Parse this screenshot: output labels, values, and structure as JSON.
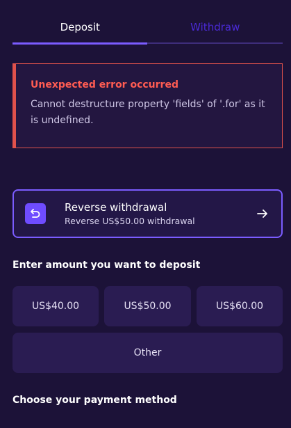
{
  "tabs": {
    "deposit": "Deposit",
    "withdraw": "Withdraw"
  },
  "error": {
    "title": "Unexpected error occurred",
    "message": "Cannot destructure property 'fields' of '.for' as it is undefined."
  },
  "reverse_withdrawal": {
    "title": "Reverse withdrawal",
    "subtitle": "Reverse US$50.00 withdrawal",
    "icon": "undo-icon",
    "arrow_icon": "arrow-right-icon"
  },
  "deposit": {
    "amount_label": "Enter amount you want to deposit",
    "amounts": [
      "US$40.00",
      "US$50.00",
      "US$60.00"
    ],
    "other_label": "Other",
    "payment_label": "Choose your payment method"
  },
  "colors": {
    "background": "#1c1238",
    "accent": "#7b5cff",
    "error": "#ff5c52",
    "card": "#2a1c52"
  }
}
